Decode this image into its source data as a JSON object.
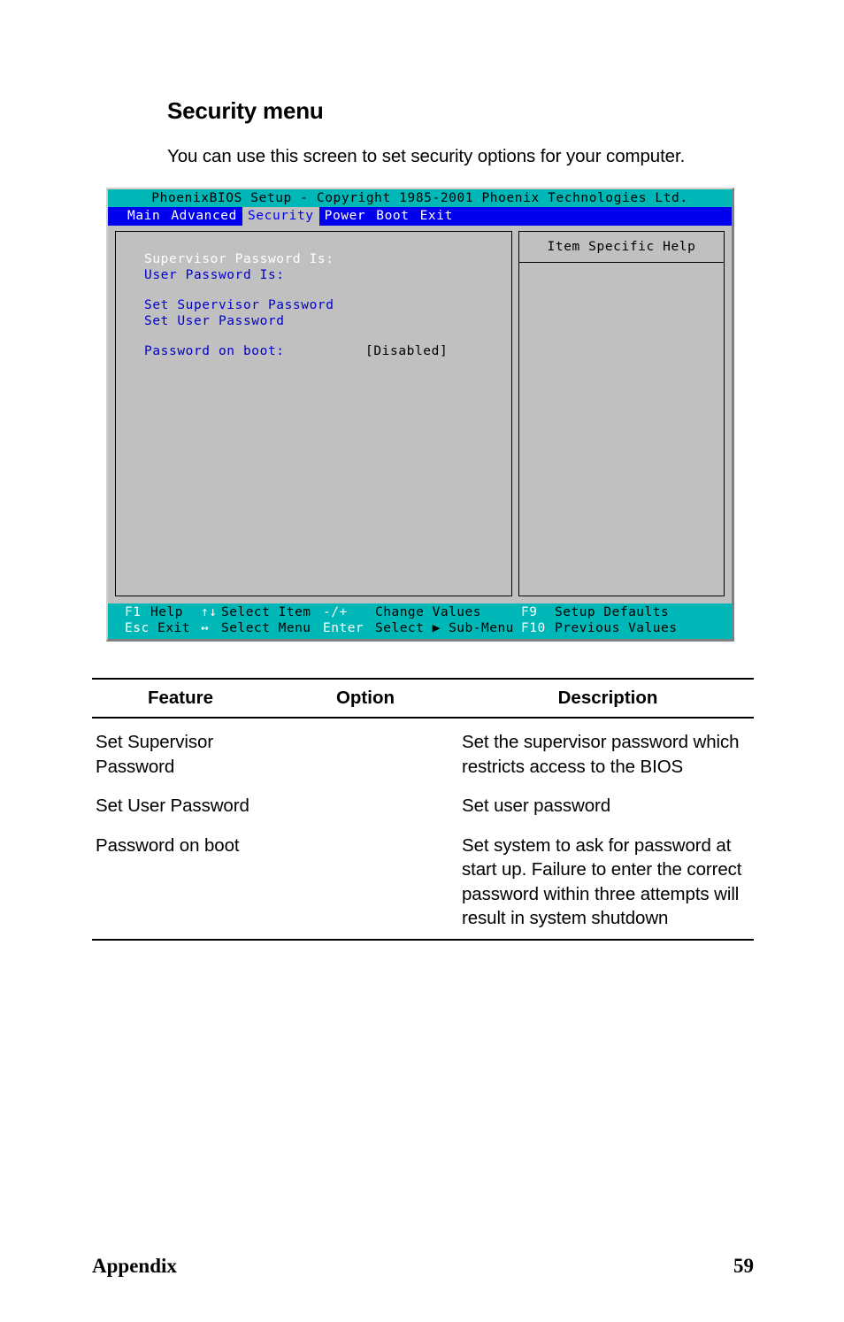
{
  "document": {
    "heading": "Security menu",
    "paragraph": "You can use this screen to set security options for your computer.",
    "footer_left": "Appendix",
    "footer_page": "59"
  },
  "bios": {
    "title": "PhoenixBIOS Setup - Copyright 1985-2001 Phoenix Technologies Ltd.",
    "menu": [
      {
        "label": "Main",
        "active": false
      },
      {
        "label": "Advanced",
        "active": false
      },
      {
        "label": "Security",
        "active": true
      },
      {
        "label": "Power",
        "active": false
      },
      {
        "label": "Boot",
        "active": false
      },
      {
        "label": "Exit",
        "active": false
      }
    ],
    "help_title": "Item Specific Help",
    "items": [
      {
        "label": "Supervisor Password Is:",
        "value": "",
        "state": "dim"
      },
      {
        "label": "User Password Is:",
        "value": "",
        "state": "blue"
      },
      {
        "label": "Set Supervisor Password",
        "value": "",
        "state": "blue"
      },
      {
        "label": "Set User Password",
        "value": "",
        "state": "blue"
      },
      {
        "label": "Password on boot:",
        "value": "[Disabled]",
        "state": "blue"
      }
    ],
    "footer_keys": [
      {
        "key": "F1",
        "desc": "Help"
      },
      {
        "key": "↑↓",
        "desc": "Select Item"
      },
      {
        "key": "-/+",
        "desc": "Change Values"
      },
      {
        "key": "F9",
        "desc": "Setup Defaults"
      },
      {
        "key": "Esc",
        "desc": "Exit"
      },
      {
        "key": "↔",
        "desc": "Select Menu"
      },
      {
        "key": "Enter",
        "desc": "Select ▶ Sub-Menu"
      },
      {
        "key": "F10",
        "desc": "Previous Values"
      }
    ],
    "colors": {
      "titlebar": "#00b7b7",
      "menubar": "#0000ee",
      "panel": "#c0c0c0",
      "item_text": "#0000cc",
      "dim_text": "#ffffff",
      "value_text": "#000000"
    }
  },
  "table": {
    "headers": [
      "Feature",
      "Option",
      "Description"
    ],
    "rows": [
      {
        "feature": "Set Supervisor Password",
        "option": "",
        "description": "Set the supervisor password which restricts access to the BIOS"
      },
      {
        "feature": "Set User Password",
        "option": "",
        "description": "Set user password"
      },
      {
        "feature": "Password on boot",
        "option": "",
        "description": "Set system to ask for password at start up. Failure to enter the correct password within three attempts will result in system shutdown"
      }
    ]
  }
}
